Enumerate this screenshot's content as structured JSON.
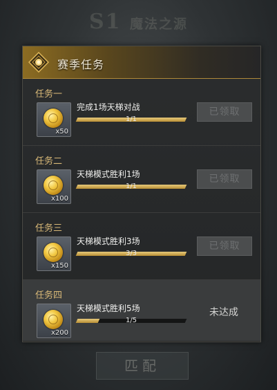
{
  "background_title": {
    "s1": "S1",
    "subtitle": "魔法之源"
  },
  "panel": {
    "title": "赛季任务",
    "icon": "season-emblem-icon"
  },
  "tasks": [
    {
      "name": "任务一",
      "reward_icon": "gold-coin-icon",
      "reward_qty": "x50",
      "desc": "完成1场天梯对战",
      "progress_text": "1/1",
      "progress": 1.0,
      "status": "已领取"
    },
    {
      "name": "任务二",
      "reward_icon": "gold-coin-icon",
      "reward_qty": "x100",
      "desc": "天梯模式胜利1场",
      "progress_text": "1/1",
      "progress": 1.0,
      "status": "已领取"
    },
    {
      "name": "任务三",
      "reward_icon": "gold-coin-icon",
      "reward_qty": "x150",
      "desc": "天梯模式胜利3场",
      "progress_text": "3/3",
      "progress": 1.0,
      "status": "已领取"
    },
    {
      "name": "任务四",
      "reward_icon": "gold-coin-icon",
      "reward_qty": "x200",
      "desc": "天梯模式胜利5场",
      "progress_text": "1/5",
      "progress": 0.2,
      "status": "未达成"
    }
  ],
  "match_button": {
    "label": "匹配"
  },
  "colors": {
    "accent_gold": "#d9b978",
    "progress_gold": "#c9a24a",
    "panel_bg": "#2b2d2e"
  }
}
